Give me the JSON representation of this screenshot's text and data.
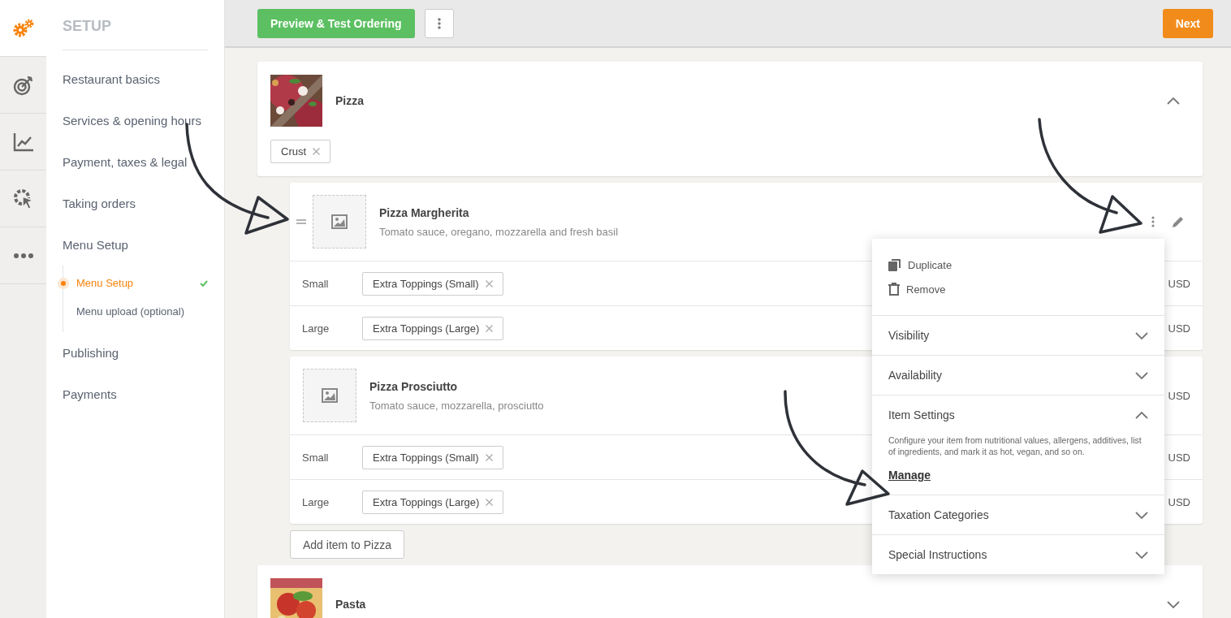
{
  "rail": [
    {
      "kind": "gears",
      "selected": true
    },
    {
      "kind": "target",
      "selected": false
    },
    {
      "kind": "chart",
      "selected": false
    },
    {
      "kind": "cursor",
      "selected": false
    },
    {
      "kind": "more",
      "selected": false
    }
  ],
  "sidebar": {
    "title": "SETUP",
    "items": [
      {
        "label": "Restaurant basics",
        "selected": false
      },
      {
        "label": "Services & opening hours",
        "selected": false
      },
      {
        "label": "Payment, taxes & legal",
        "selected": false
      },
      {
        "label": "Taking orders",
        "selected": false
      },
      {
        "label": "Menu Setup",
        "selected": false,
        "children": [
          {
            "label": "Menu Setup",
            "selected": true,
            "checked": true
          },
          {
            "label": "Menu upload (optional)",
            "selected": false,
            "checked": false
          }
        ]
      },
      {
        "label": "Publishing",
        "selected": false
      },
      {
        "label": "Payments",
        "selected": false
      }
    ]
  },
  "toolbar": {
    "preview_button": "Preview & Test Ordering",
    "next_button": "Next"
  },
  "categories": [
    {
      "name": "Pizza",
      "expanded": true,
      "tags": [
        "Crust"
      ],
      "items": [
        {
          "name": "Pizza Margherita",
          "description": "Tomato sauce, oregano, mozzarella and fresh basil",
          "draggable": true,
          "variants": [
            {
              "size": "Small",
              "tags": [
                "Extra Toppings (Small)"
              ],
              "price": "USD"
            },
            {
              "size": "Large",
              "tags": [
                "Extra Toppings (Large)"
              ],
              "price": "USD"
            }
          ]
        },
        {
          "name": "Pizza Prosciutto",
          "description": "Tomato sauce, mozzarella, prosciutto",
          "draggable": false,
          "price": "USD",
          "variants": [
            {
              "size": "Small",
              "tags": [
                "Extra Toppings (Small)"
              ],
              "price": "USD"
            },
            {
              "size": "Large",
              "tags": [
                "Extra Toppings (Large)"
              ],
              "price": "USD"
            }
          ]
        }
      ],
      "add_button": "Add item to Pizza"
    },
    {
      "name": "Pasta",
      "expanded": false
    }
  ],
  "item_menu": {
    "actions": [
      {
        "kind": "duplicate",
        "label": "Duplicate"
      },
      {
        "kind": "remove",
        "label": "Remove"
      }
    ],
    "sections": [
      {
        "title": "Visibility",
        "expanded": false
      },
      {
        "title": "Availability",
        "expanded": false
      },
      {
        "title": "Item Settings",
        "expanded": true,
        "description": "Configure your item from nutritional values, allergens, additives, list of ingredients, and mark it as hot, vegan, and so on.",
        "link": "Manage"
      },
      {
        "title": "Taxation Categories",
        "expanded": false
      },
      {
        "title": "Special Instructions",
        "expanded": false
      }
    ]
  }
}
